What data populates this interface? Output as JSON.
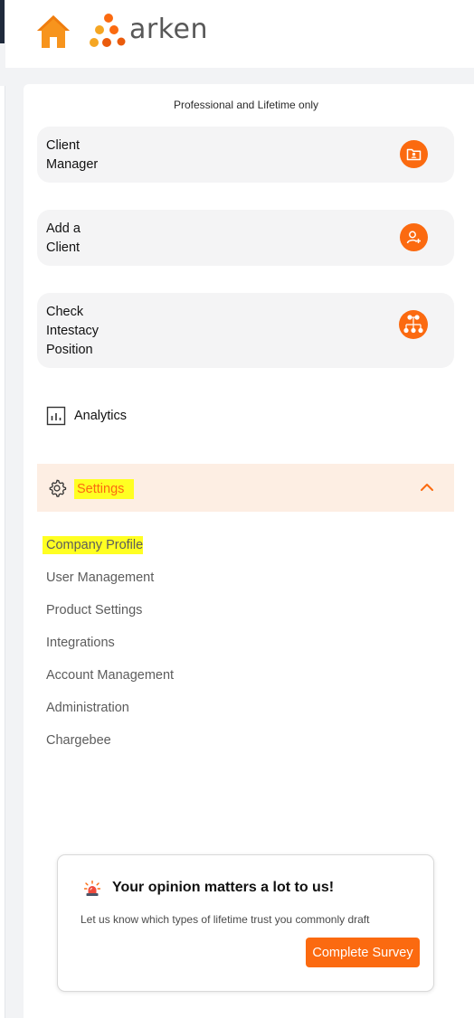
{
  "brand": {
    "logo_text": "arken",
    "accent": "#fb6a10",
    "logo_dot_colors": [
      "#fb6a10",
      "#f5a623",
      "#ea5b0c"
    ]
  },
  "header": {
    "home_icon": "home-icon"
  },
  "sidebar": {
    "note": "Professional and Lifetime only",
    "cards": [
      {
        "label": "Client\nManager",
        "icon": "folder-user-icon"
      },
      {
        "label": "Add a\nClient",
        "icon": "user-plus-icon"
      },
      {
        "label": "Check\nIntestacy\nPosition",
        "icon": "family-tree-icon"
      }
    ],
    "analytics": {
      "label": "Analytics",
      "icon": "bar-chart-icon"
    },
    "settings": {
      "label": "Settings",
      "icon": "gear-icon",
      "expanded": true,
      "highlight_color": "#ffff22",
      "items": [
        {
          "label": "Company Profile",
          "active": true
        },
        {
          "label": "User Management",
          "active": false
        },
        {
          "label": "Product Settings",
          "active": false
        },
        {
          "label": "Integrations",
          "active": false
        },
        {
          "label": "Account Management",
          "active": false
        },
        {
          "label": "Administration",
          "active": false
        },
        {
          "label": "Chargebee",
          "active": false
        }
      ]
    }
  },
  "survey": {
    "icon": "alarm-light-icon",
    "title": "Your opinion matters a lot to us!",
    "text": "Let us know which types of lifetime trust you commonly draft",
    "button_label": "Complete Survey"
  }
}
